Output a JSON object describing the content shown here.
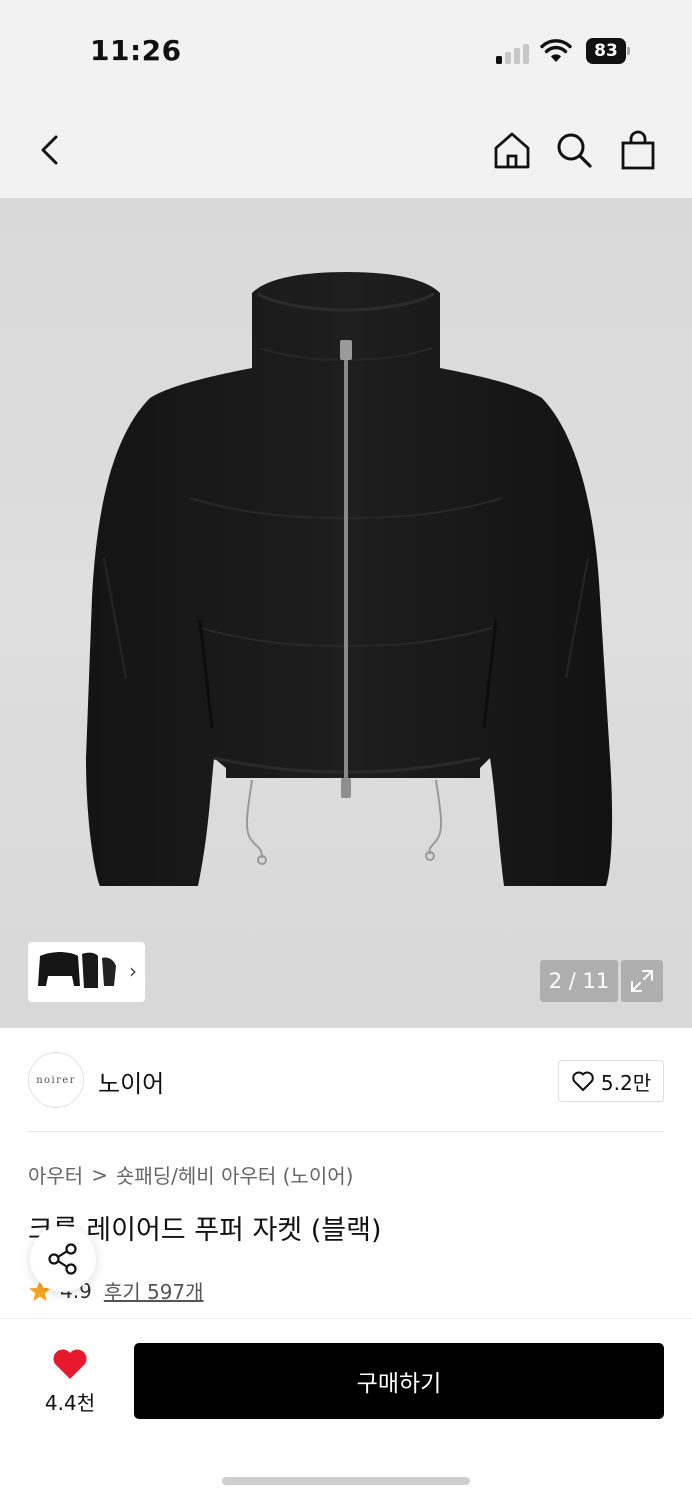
{
  "status": {
    "time": "11:26",
    "battery": "83"
  },
  "nav": {
    "back": "back",
    "home": "home",
    "search": "search",
    "bag": "shopping-bag"
  },
  "gallery": {
    "counter": "2 / 11",
    "thumb_chevron": "›"
  },
  "brand": {
    "logo_text": "noirer",
    "name": "노이어",
    "like_count": "5.2만"
  },
  "breadcrumb": {
    "parent": "아우터",
    "separator": ">",
    "child": "숏패딩/헤비 아우터 (노이어)"
  },
  "product": {
    "title": "크롭 레이어드 푸퍼 자켓 (블랙)",
    "rating": "4.9",
    "reviews": "후기 597개"
  },
  "footer": {
    "wish_count": "4.4천",
    "buy_label": "구매하기"
  },
  "colors": {
    "heart": "#e8192c",
    "star": "#f5a623",
    "button": "#000000"
  }
}
